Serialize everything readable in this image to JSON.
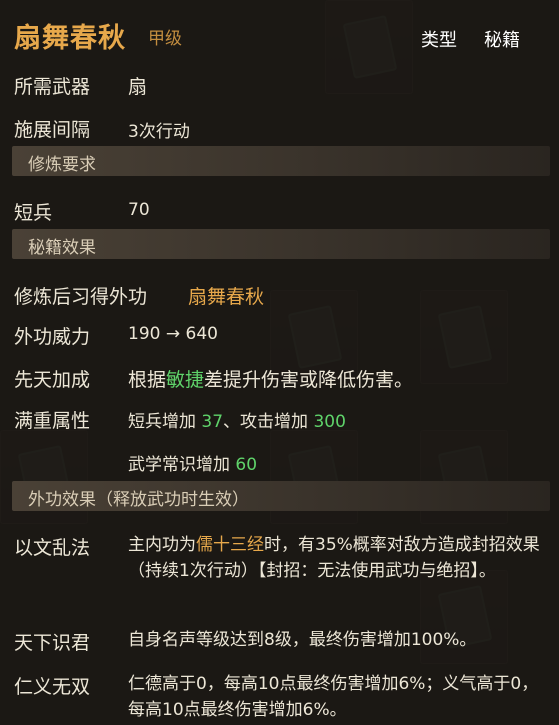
{
  "header": {
    "title": "扇舞春秋",
    "grade": "甲级",
    "type_label": "类型",
    "type_value": "秘籍"
  },
  "basic": {
    "weapon_label": "所需武器",
    "weapon_value": "扇",
    "interval_label": "施展间隔",
    "interval_value": "3次行动"
  },
  "requirements": {
    "section_title": "修炼要求",
    "short_weapon_label": "短兵",
    "short_weapon_value": "70"
  },
  "effects": {
    "section_title": "秘籍效果",
    "learn_label": "修炼后习得外功",
    "learn_value": "扇舞春秋",
    "power_label": "外功威力",
    "power_value": "190 → 640",
    "innate_label": "先天加成",
    "innate_prefix": "根据",
    "innate_highlight": "敏捷",
    "innate_suffix": "差提升伤害或降低伤害。",
    "full_label": "满重属性",
    "full_line1_a": "短兵增加 ",
    "full_line1_a_val": "37",
    "full_line1_b": "、攻击增加 ",
    "full_line1_b_val": "300",
    "full_line2_a": "武学常识增加 ",
    "full_line2_a_val": "60"
  },
  "release": {
    "section_title": "外功效果（释放武功时生效）",
    "e1_label": "以文乱法",
    "e1_text_a": "主内功为",
    "e1_highlight": "儒十三经",
    "e1_text_b": "时，有35%概率对敌方造成封招效果（持续1次行动）【封招：无法使用武功与绝招】。",
    "e2_label": "天下识君",
    "e2_text": "自身名声等级达到8级，最终伤害增加100%。",
    "e3_label": "仁义无双",
    "e3_text": "仁德高于0，每高10点最终伤害增加6%；义气高于0，每高10点最终伤害增加6%。"
  },
  "colors": {
    "gold": "#e7a84b",
    "green": "#5fd36a",
    "text": "#ece6d6"
  }
}
